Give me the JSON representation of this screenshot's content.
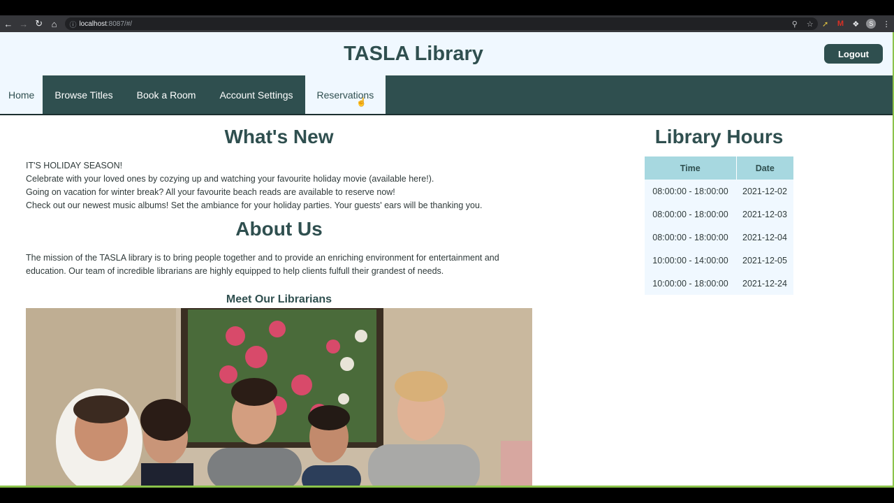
{
  "browser": {
    "url_host": "localhost",
    "url_path": ":8087/#/",
    "avatar_letter": "S"
  },
  "header": {
    "title": "TASLA Library",
    "logout_label": "Logout"
  },
  "nav": {
    "tabs": [
      {
        "label": "Home"
      },
      {
        "label": "Browse Titles"
      },
      {
        "label": "Book a Room"
      },
      {
        "label": "Account Settings"
      },
      {
        "label": "Reservations"
      }
    ]
  },
  "whats_new": {
    "heading": "What's New",
    "lines": [
      "IT'S HOLIDAY SEASON!",
      "Celebrate with your loved ones by cozying up and watching your favourite holiday movie (available here!).",
      "Going on vacation for winter break? All your favourite beach reads are available to reserve now!",
      "Check out our newest music albums! Set the ambiance for your holiday parties. Your guests' ears will be thanking you."
    ]
  },
  "about": {
    "heading": "About Us",
    "text": "The mission of the TASLA library is to bring people together and to provide an enriching environment for entertainment and education. Our team of incredible librarians are highly equipped to help clients fulfull their grandest of needs.",
    "librarians_heading": "Meet Our Librarians"
  },
  "hours": {
    "heading": "Library Hours",
    "columns": [
      "Time",
      "Date"
    ],
    "rows": [
      [
        "08:00:00 - 18:00:00",
        "2021-12-02"
      ],
      [
        "08:00:00 - 18:00:00",
        "2021-12-03"
      ],
      [
        "08:00:00 - 18:00:00",
        "2021-12-04"
      ],
      [
        "10:00:00 - 14:00:00",
        "2021-12-05"
      ],
      [
        "10:00:00 - 18:00:00",
        "2021-12-24"
      ]
    ]
  },
  "colors": {
    "brand": "#2f4f4f",
    "header_bg": "#f0f8ff",
    "table_header": "#a7d8e0"
  }
}
